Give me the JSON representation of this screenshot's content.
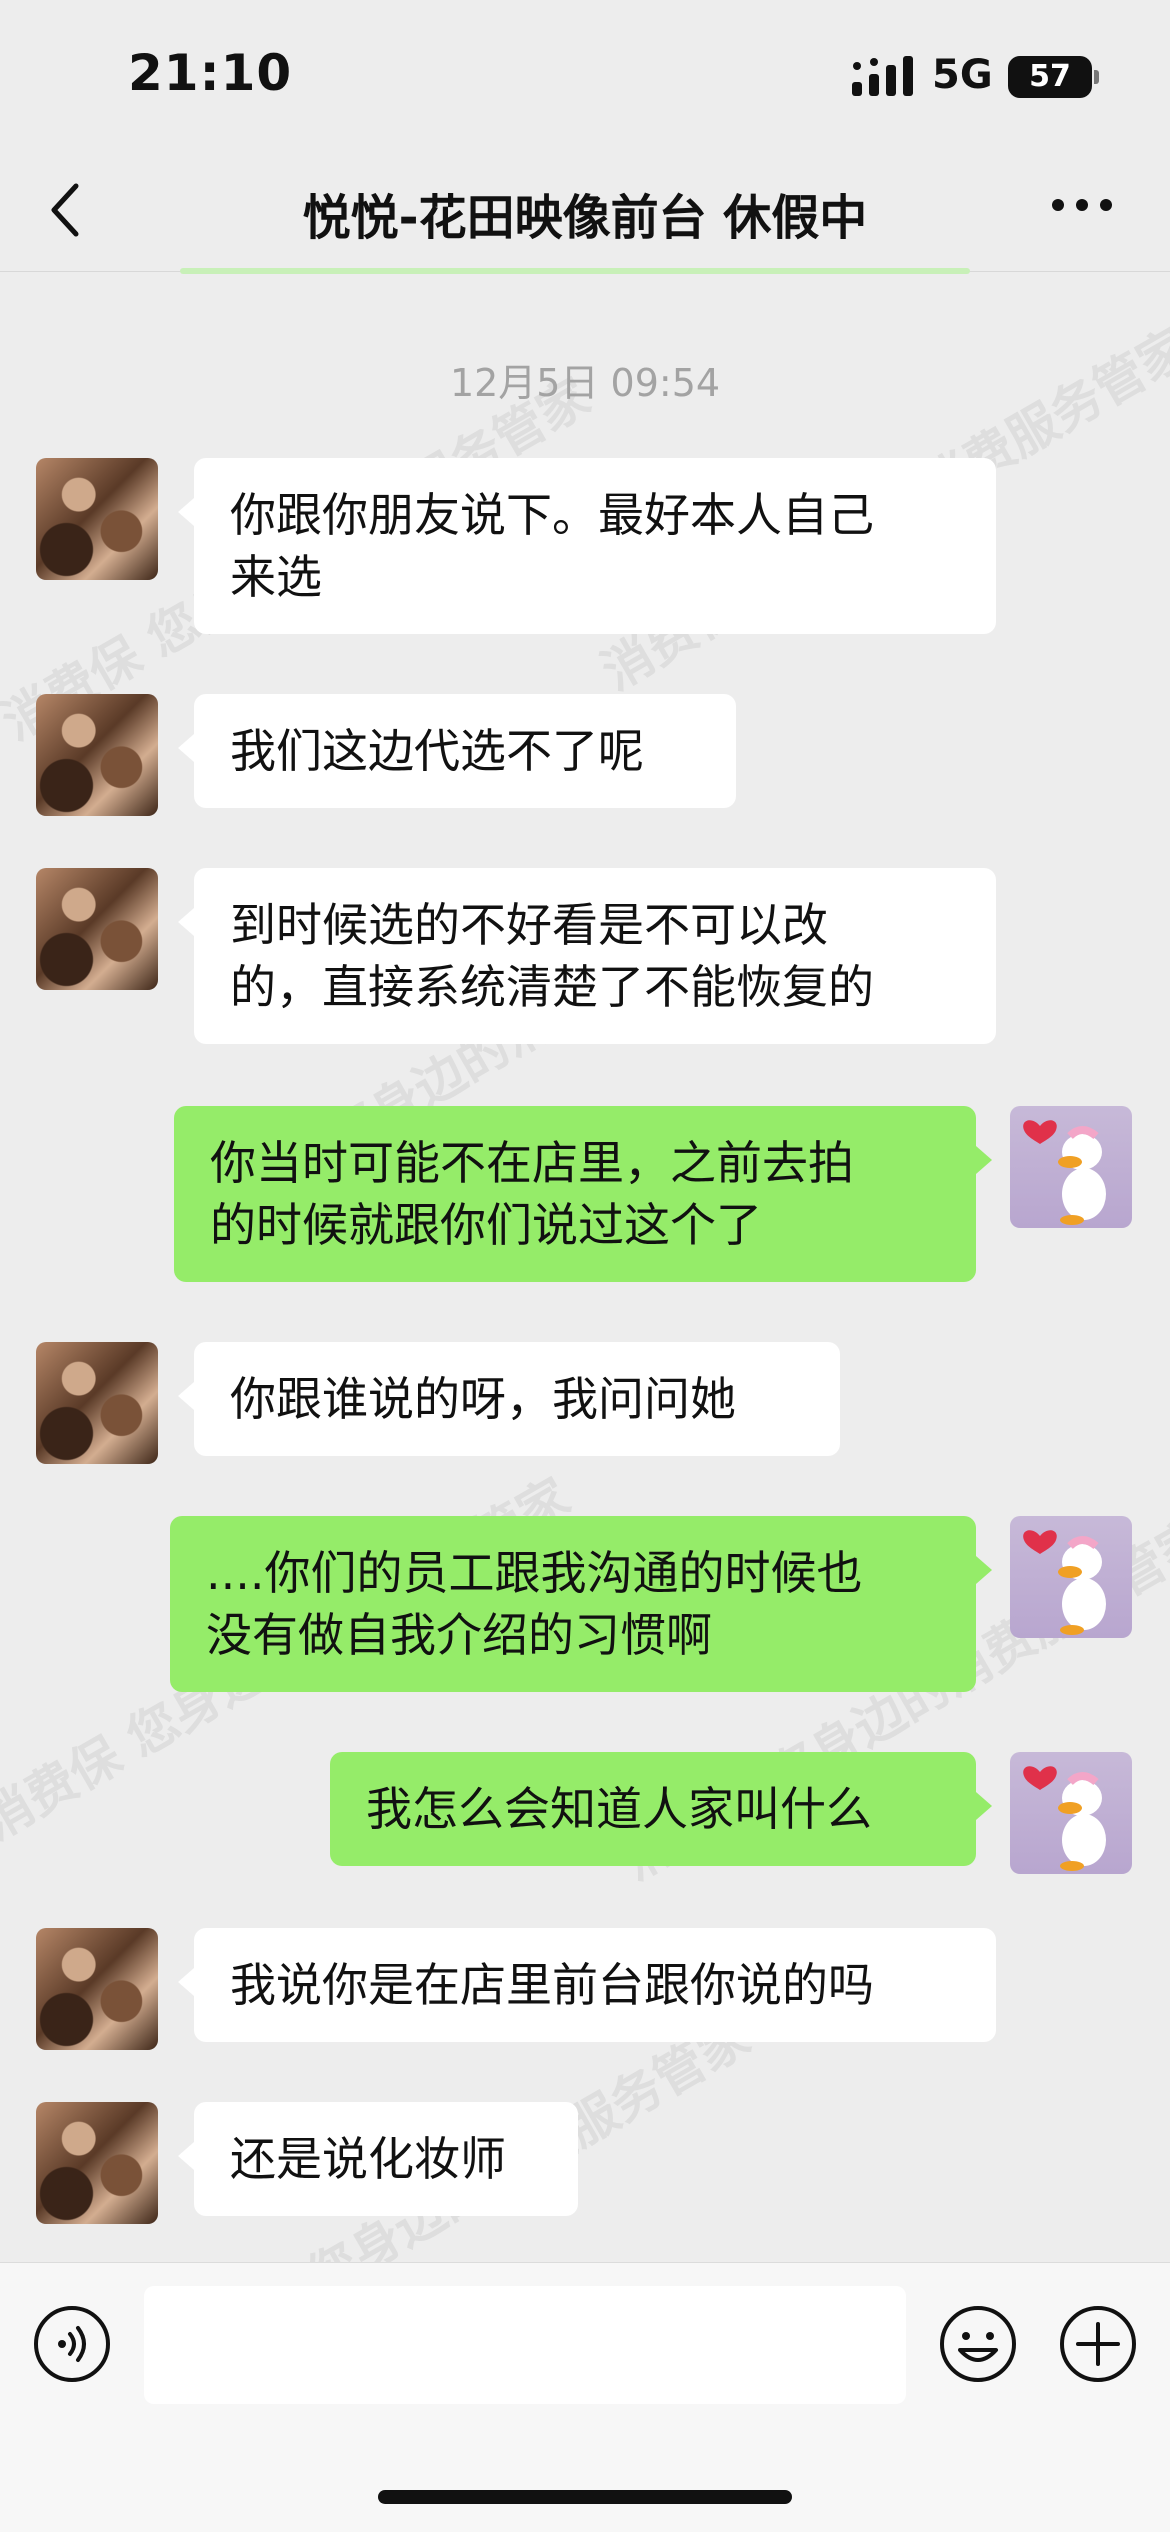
{
  "status": {
    "time": "21:10",
    "network": "5G",
    "battery": "57"
  },
  "nav": {
    "title": "悦悦-花田映像前台 休假中"
  },
  "timestamp": "12月5日 09:54",
  "messages": [
    {
      "side": "left",
      "text": "你跟你朋友说下。最好本人自己\n来选"
    },
    {
      "side": "left",
      "text": "我们这边代选不了呢"
    },
    {
      "side": "left",
      "text": "到时候选的不好看是不可以改\n的，直接系统清楚了不能恢复的"
    },
    {
      "side": "right",
      "text": "你当时可能不在店里，之前去拍\n的时候就跟你们说过这个了"
    },
    {
      "side": "left",
      "text": "你跟谁说的呀，我问问她"
    },
    {
      "side": "right",
      "text": "....你们的员工跟我沟通的时候也\n没有做自我介绍的习惯啊"
    },
    {
      "side": "right",
      "text": "我怎么会知道人家叫什么"
    },
    {
      "side": "left",
      "text": "我说你是在店里前台跟你说的吗"
    },
    {
      "side": "left",
      "text": "还是说化妆师"
    }
  ],
  "input": {
    "value": ""
  },
  "watermark": "消费保 您身边的消费服务管家",
  "colors": {
    "self_bubble": "#95ec69",
    "other_bubble": "#ffffff",
    "background": "#ededed"
  }
}
